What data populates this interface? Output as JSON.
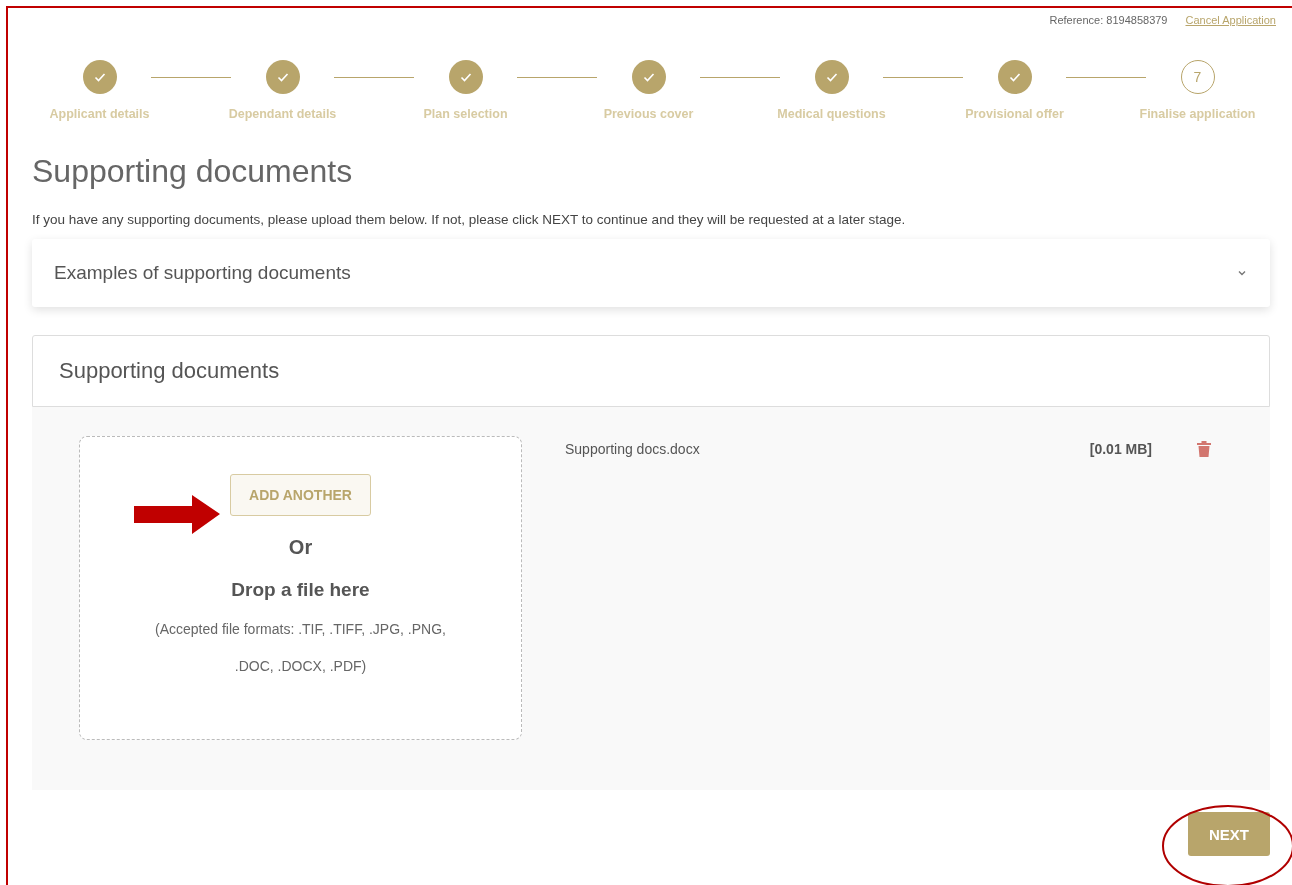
{
  "header": {
    "reference": "Reference: 8194858379",
    "cancel_link": "Cancel Application"
  },
  "steps": [
    {
      "label": "Applicant details",
      "completed": true
    },
    {
      "label": "Dependant details",
      "completed": true
    },
    {
      "label": "Plan selection",
      "completed": true
    },
    {
      "label": "Previous cover",
      "completed": true
    },
    {
      "label": "Medical questions",
      "completed": true
    },
    {
      "label": "Provisional offer",
      "completed": true
    },
    {
      "label": "Finalise application",
      "completed": false,
      "number": "7"
    }
  ],
  "title": "Supporting documents",
  "intro": "If you have any supporting documents, please upload them below. If not, please click NEXT to continue and they will be requested at a later stage.",
  "accordion": {
    "title": "Examples of supporting documents",
    "expanded": false
  },
  "upload": {
    "title": "Supporting documents",
    "add_button": "ADD ANOTHER",
    "or": "Or",
    "drop_text": "Drop a file here",
    "formats_line1": "(Accepted file formats: .TIF, .TIFF, .JPG, .PNG,",
    "formats_line2": ".DOC, .DOCX, .PDF)",
    "files": [
      {
        "name": "Supporting docs.docx",
        "size": "[0.01 MB]"
      }
    ]
  },
  "next_button": "NEXT"
}
